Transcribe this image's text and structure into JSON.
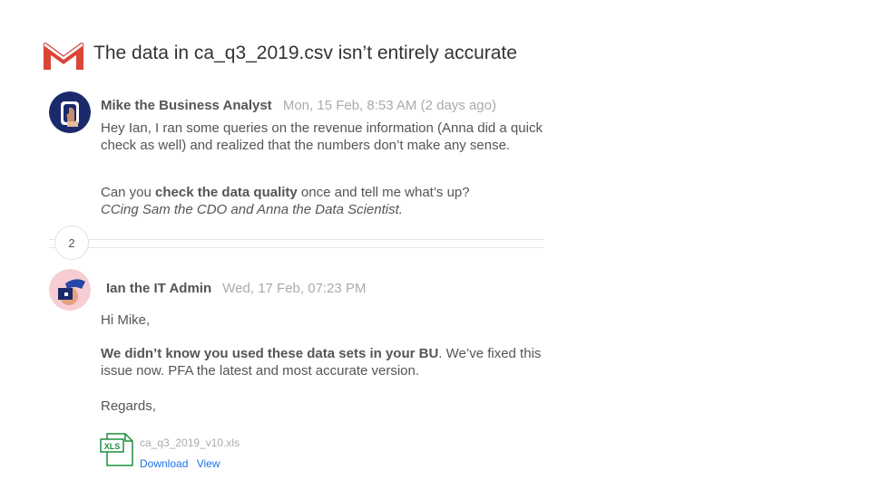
{
  "thread": {
    "subject": "The data in ca_q3_2019.csv isn’t entirely accurate",
    "collapsed_count": "2"
  },
  "messages": [
    {
      "sender": "Mike the Business Analyst",
      "date": "Mon, 15 Feb, 8:53 AM (2 days ago)",
      "p1": "Hey Ian, I ran some queries on the revenue information (Anna did a quick check as well) and realized that the numbers don’t make any sense.",
      "p2_pre": "Can you ",
      "p2_bold": "check the data quality",
      "p2_post": " once and tell me what’s up?",
      "p2_italic": "CCing Sam the CDO and Anna the Data Scientist."
    },
    {
      "sender": "Ian the IT Admin",
      "date": "Wed, 17 Feb, 07:23 PM",
      "greeting": "Hi Mike,",
      "body_bold": "We didn’t know you used these data sets in your BU",
      "body_rest": ". We’ve fixed this issue now. PFA the latest and most accurate version.",
      "signoff": "Regards,"
    }
  ],
  "attachment": {
    "icon_label": "XLS",
    "file_name": "ca_q3_2019_v10.xls",
    "download_label": "Download",
    "view_label": "View"
  },
  "colors": {
    "gmail_red": "#db4437",
    "link_blue": "#1a73e8",
    "xls_green": "#1e8e3e"
  },
  "icons": [
    "gmail-icon",
    "avatar",
    "xls-file-icon"
  ]
}
